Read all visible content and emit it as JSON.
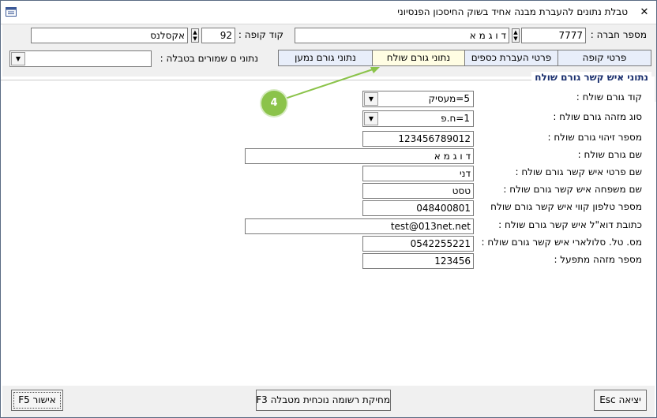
{
  "window": {
    "title": "טבלת נתונים להעברת מבנה אחיד בשוק החיסכון הפנסיוני",
    "close_glyph": "✕"
  },
  "header": {
    "company_label": "מספר חברה :",
    "company_number": "7777",
    "company_name": "ד ו ג מ א",
    "fund_label": "קוד קופה :",
    "fund_code": "92",
    "fund_name": "אקסלנס"
  },
  "tabs": [
    {
      "label": "פרטי קופה"
    },
    {
      "label": "פרטי העברת כספים"
    },
    {
      "label": "נתוני גורם שולח"
    },
    {
      "label": "נתוני גורם נמען"
    }
  ],
  "saved_data": {
    "label": "נתוני ם שמורים בטבלה :",
    "value": ""
  },
  "section": {
    "title": "נתוני איש קשר גורם שולח"
  },
  "form": {
    "sender_code": {
      "label": "קוד גורם שולח :",
      "value": "5=מעסיק"
    },
    "identifier_type": {
      "label": "סוג מזהה גורם שולח :",
      "value": "1=ח.פ"
    },
    "id_number": {
      "label": "מספר זיהוי גורם שולח :",
      "value": "123456789012"
    },
    "sender_name": {
      "label": "שם גורם שולח :",
      "value": "ד ו ג מ א"
    },
    "contact_first_name": {
      "label": "שם פרטי איש קשר גורם שולח :",
      "value": "דני"
    },
    "contact_last_name": {
      "label": "שם משפחה איש קשר גורם שולח :",
      "value": "טסט"
    },
    "contact_phone": {
      "label": "מספר טלפון קווי איש קשר גורם שולח",
      "value": "048400801"
    },
    "contact_email": {
      "label": "כתובת דוא\"ל איש קשר גורם שולח :",
      "value": "test@013net.net"
    },
    "contact_mobile": {
      "label": "מס. טל. סלולארי איש קשר גורם שולח :",
      "value": "0542255221"
    },
    "operator_id": {
      "label": "מספר מזהה מתפעל :",
      "value": "123456"
    }
  },
  "buttons": {
    "esc": "יציאה Esc",
    "delete": "מחיקת רשומה נוכחית מטבלה F3",
    "confirm": "אישור F5"
  },
  "annotation": {
    "step": "4"
  },
  "colors": {
    "badge": "#8bc34a",
    "active_tab": "#fffde3",
    "tab": "#e8eefa",
    "section_title": "#1a2f6e"
  }
}
